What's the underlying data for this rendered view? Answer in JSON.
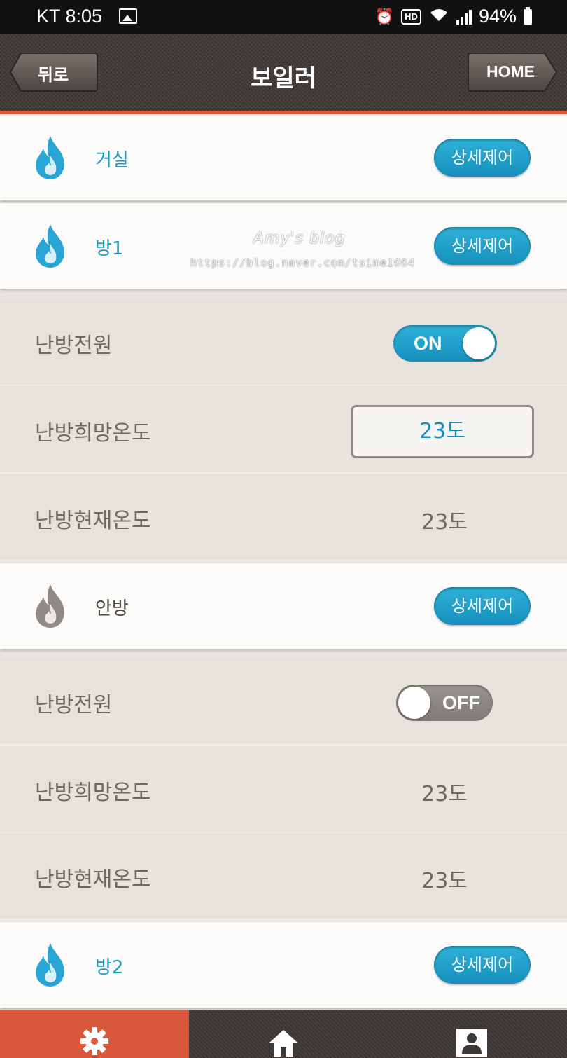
{
  "status_bar": {
    "carrier_time": "KT 8:05",
    "battery": "94%",
    "hd_label": "HD"
  },
  "header": {
    "back_label": "뒤로",
    "title": "보일러",
    "home_label": "HOME"
  },
  "rooms": [
    {
      "name": "거실",
      "detail_label": "상세제어",
      "active": true
    },
    {
      "name": "방1",
      "detail_label": "상세제어",
      "active": true
    },
    {
      "name": "안방",
      "detail_label": "상세제어",
      "active": false
    },
    {
      "name": "방2",
      "detail_label": "상세제어",
      "active": true
    }
  ],
  "room1_settings": {
    "power_label": "난방전원",
    "power_state": "ON",
    "target_label": "난방희망온도",
    "target_value": "23도",
    "current_label": "난방현재온도",
    "current_value": "23도"
  },
  "anbang_settings": {
    "power_label": "난방전원",
    "power_state": "OFF",
    "target_label": "난방희망온도",
    "target_value": "23도",
    "current_label": "난방현재온도",
    "current_value": "23도"
  },
  "watermark": {
    "line1": "Amy's blog",
    "line2": "https://blog.naver.com/tsime1004"
  },
  "colors": {
    "accent_blue": "#1a9bc7",
    "accent_orange": "#d9573b",
    "flame_inactive": "#8f8a85"
  },
  "bottom_nav": [
    {
      "icon": "gear-icon",
      "active": true
    },
    {
      "icon": "home-icon",
      "active": false
    },
    {
      "icon": "user-icon",
      "active": false
    }
  ]
}
